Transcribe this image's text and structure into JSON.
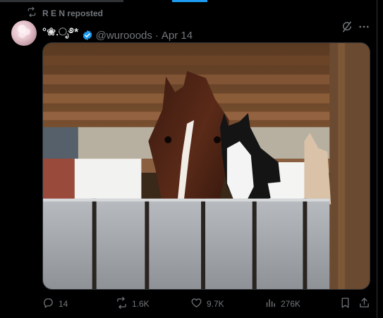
{
  "repost": {
    "text": "R E N reposted"
  },
  "tweet": {
    "display_name": "°❀.ೃ࿔*",
    "handle": "@wurooods",
    "separator": "·",
    "date": "Apr 14",
    "media": {
      "subject": "horse and black-and-white cat looking over a wooden stall door"
    }
  },
  "actions": {
    "replies": "14",
    "reposts": "1.6K",
    "likes": "9.7K",
    "views": "276K"
  },
  "icons": {
    "repost": "repost-icon",
    "verified": "verified-badge-icon",
    "grok": "grok-icon",
    "more": "more-options-icon",
    "reply": "reply-icon",
    "like": "heart-icon",
    "views": "views-icon",
    "bookmark": "bookmark-icon",
    "share": "share-icon"
  },
  "colors": {
    "background": "#000000",
    "text": "#e7e9ea",
    "muted": "#71767b",
    "accent": "#1d9bf0",
    "border": "#2f3336"
  }
}
